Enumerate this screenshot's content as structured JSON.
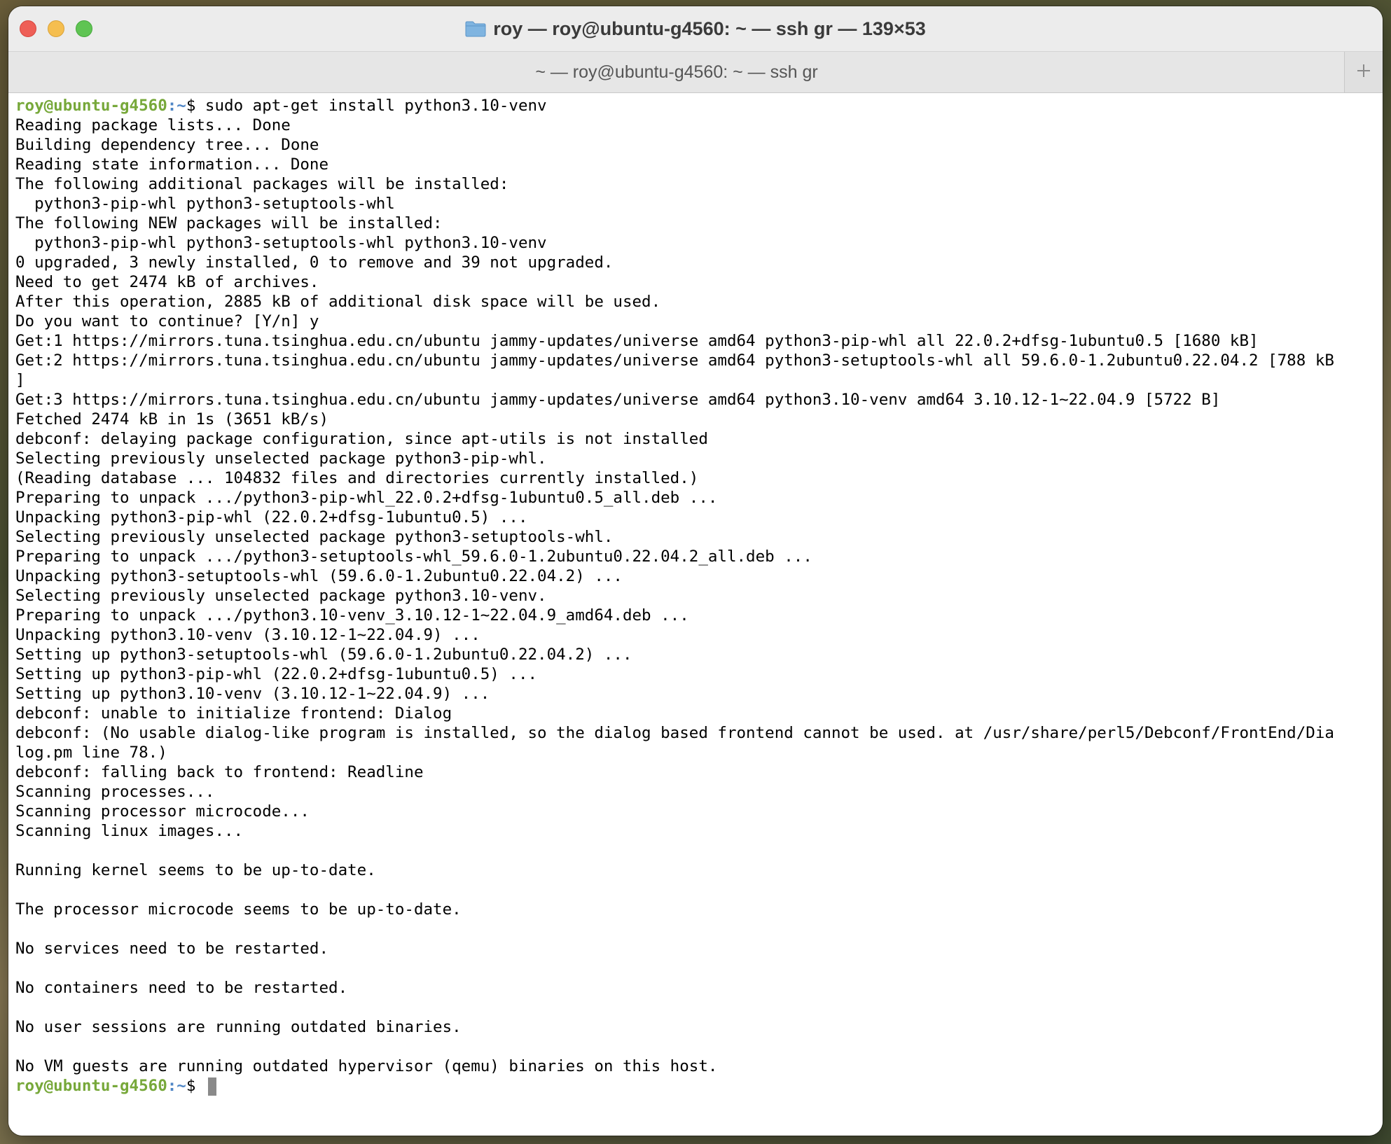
{
  "window": {
    "title": "roy — roy@ubuntu-g4560: ~ — ssh gr — 139×53",
    "tab_label": "~ — roy@ubuntu-g4560: ~ — ssh gr",
    "new_tab_label": "+"
  },
  "terminal": {
    "command": {
      "user_host": "roy@ubuntu-g4560",
      "path": ":~",
      "symbol": "$",
      "text": " sudo apt-get install python3.10-venv"
    },
    "output": [
      "Reading package lists... Done",
      "Building dependency tree... Done",
      "Reading state information... Done",
      "The following additional packages will be installed:",
      "  python3-pip-whl python3-setuptools-whl",
      "The following NEW packages will be installed:",
      "  python3-pip-whl python3-setuptools-whl python3.10-venv",
      "0 upgraded, 3 newly installed, 0 to remove and 39 not upgraded.",
      "Need to get 2474 kB of archives.",
      "After this operation, 2885 kB of additional disk space will be used.",
      "Do you want to continue? [Y/n] y",
      "Get:1 https://mirrors.tuna.tsinghua.edu.cn/ubuntu jammy-updates/universe amd64 python3-pip-whl all 22.0.2+dfsg-1ubuntu0.5 [1680 kB]",
      "Get:2 https://mirrors.tuna.tsinghua.edu.cn/ubuntu jammy-updates/universe amd64 python3-setuptools-whl all 59.6.0-1.2ubuntu0.22.04.2 [788 kB",
      "]",
      "Get:3 https://mirrors.tuna.tsinghua.edu.cn/ubuntu jammy-updates/universe amd64 python3.10-venv amd64 3.10.12-1~22.04.9 [5722 B]",
      "Fetched 2474 kB in 1s (3651 kB/s)",
      "debconf: delaying package configuration, since apt-utils is not installed",
      "Selecting previously unselected package python3-pip-whl.",
      "(Reading database ... 104832 files and directories currently installed.)",
      "Preparing to unpack .../python3-pip-whl_22.0.2+dfsg-1ubuntu0.5_all.deb ...",
      "Unpacking python3-pip-whl (22.0.2+dfsg-1ubuntu0.5) ...",
      "Selecting previously unselected package python3-setuptools-whl.",
      "Preparing to unpack .../python3-setuptools-whl_59.6.0-1.2ubuntu0.22.04.2_all.deb ...",
      "Unpacking python3-setuptools-whl (59.6.0-1.2ubuntu0.22.04.2) ...",
      "Selecting previously unselected package python3.10-venv.",
      "Preparing to unpack .../python3.10-venv_3.10.12-1~22.04.9_amd64.deb ...",
      "Unpacking python3.10-venv (3.10.12-1~22.04.9) ...",
      "Setting up python3-setuptools-whl (59.6.0-1.2ubuntu0.22.04.2) ...",
      "Setting up python3-pip-whl (22.0.2+dfsg-1ubuntu0.5) ...",
      "Setting up python3.10-venv (3.10.12-1~22.04.9) ...",
      "debconf: unable to initialize frontend: Dialog",
      "debconf: (No usable dialog-like program is installed, so the dialog based frontend cannot be used. at /usr/share/perl5/Debconf/FrontEnd/Dia",
      "log.pm line 78.)",
      "debconf: falling back to frontend: Readline",
      "Scanning processes...",
      "Scanning processor microcode...",
      "Scanning linux images...",
      "",
      "Running kernel seems to be up-to-date.",
      "",
      "The processor microcode seems to be up-to-date.",
      "",
      "No services need to be restarted.",
      "",
      "No containers need to be restarted.",
      "",
      "No user sessions are running outdated binaries.",
      "",
      "No VM guests are running outdated hypervisor (qemu) binaries on this host."
    ],
    "final_prompt": {
      "user_host": "roy@ubuntu-g4560",
      "path": ":~",
      "symbol": "$ "
    }
  },
  "colors": {
    "prompt_user": "#77a83a",
    "prompt_path": "#4f86c6",
    "close": "#ee5f57",
    "minimize": "#f5be4f",
    "zoom": "#5fc453",
    "folder": "#7fb4e0"
  },
  "icons": {
    "title_icon": "folder-icon",
    "new_tab_icon": "plus-icon"
  }
}
